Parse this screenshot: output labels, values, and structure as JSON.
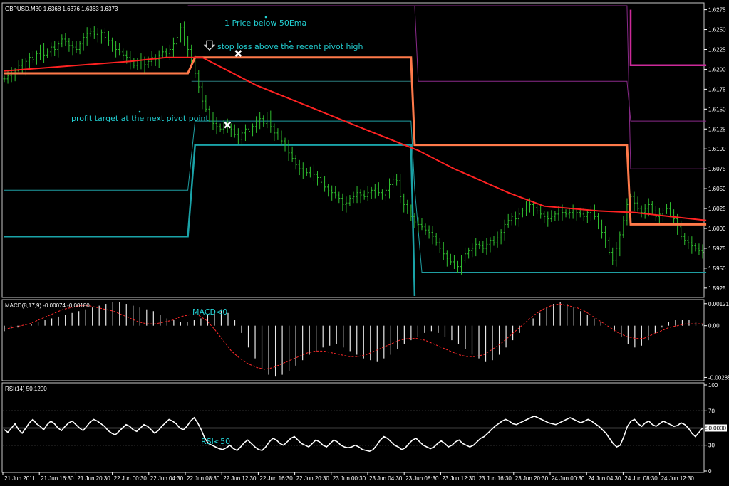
{
  "chart_data": [
    {
      "type": "line",
      "panel": "price",
      "title": "GBPUSD,M30  1.6368 1.6376 1.6363 1.6373",
      "ylim": [
        1.5915,
        1.628
      ],
      "y_ticks": [
        "1.6275",
        "1.6250",
        "1.6225",
        "1.6200",
        "1.6175",
        "1.6150",
        "1.6125",
        "1.6100",
        "1.6075",
        "1.6050",
        "1.6025",
        "1.6000",
        "1.5975",
        "1.5950",
        "1.5925"
      ],
      "x_ticks": [
        "21 Jun 2011",
        "21 Jun 16:30",
        "21 Jun 20:30",
        "22 Jun 00:30",
        "22 Jun 04:30",
        "22 Jun 08:30",
        "22 Jun 12:30",
        "22 Jun 16:30",
        "22 Jun 20:30",
        "23 Jun 00:30",
        "23 Jun 04:30",
        "23 Jun 08:30",
        "23 Jun 12:30",
        "23 Jun 16:30",
        "23 Jun 20:30",
        "24 Jun 00:30",
        "24 Jun 04:30",
        "24 Jun 08:30",
        "24 Jun 12:30"
      ],
      "bar_count": 195,
      "close": [
        1.6188,
        1.6192,
        1.6195,
        1.6198,
        1.6205,
        1.62,
        1.621,
        1.6215,
        1.6212,
        1.622,
        1.6225,
        1.6218,
        1.6222,
        1.6228,
        1.6225,
        1.6232,
        1.6238,
        1.6235,
        1.623,
        1.6228,
        1.6225,
        1.6232,
        1.624,
        1.6245,
        1.6248,
        1.6244,
        1.6242,
        1.6246,
        1.624,
        1.6236,
        1.623,
        1.6225,
        1.6222,
        1.6218,
        1.6215,
        1.621,
        1.6205,
        1.6208,
        1.6212,
        1.6206,
        1.621,
        1.6215,
        1.6212,
        1.6218,
        1.6222,
        1.622,
        1.6225,
        1.6232,
        1.624,
        1.6252,
        1.6238,
        1.6225,
        1.621,
        1.6195,
        1.6178,
        1.616,
        1.615,
        1.614,
        1.6132,
        1.6128,
        1.6125,
        1.613,
        1.6128,
        1.6125,
        1.6118,
        1.6112,
        1.612,
        1.6125,
        1.6122,
        1.6128,
        1.6135,
        1.6138,
        1.6132,
        1.614,
        1.6128,
        1.612,
        1.6115,
        1.611,
        1.6105,
        1.6095,
        1.6088,
        1.608,
        1.6075,
        1.6072,
        1.607,
        1.6072,
        1.6068,
        1.6064,
        1.6058,
        1.6052,
        1.6048,
        1.6045,
        1.6042,
        1.6038,
        1.603,
        1.6032,
        1.6038,
        1.604,
        1.6045,
        1.6042,
        1.604,
        1.6045,
        1.6048,
        1.605,
        1.6045,
        1.6042,
        1.6048,
        1.6055,
        1.6062,
        1.606,
        1.604,
        1.603,
        1.6022,
        1.6015,
        1.6008,
        1.6005,
        1.6002,
        1.5998,
        1.5995,
        1.599,
        1.5982,
        1.5975,
        1.5968,
        1.5962,
        1.5958,
        1.5955,
        1.5952,
        1.596,
        1.5968,
        1.5972,
        1.5975,
        1.598,
        1.5978,
        1.5975,
        1.598,
        1.5985,
        1.5982,
        1.5988,
        1.5995,
        1.6005,
        1.601,
        1.6015,
        1.6012,
        1.6018,
        1.6022,
        1.6028,
        1.603,
        1.6026,
        1.6022,
        1.6018,
        1.6015,
        1.6012,
        1.6015,
        1.6018,
        1.6022,
        1.602,
        1.6018,
        1.602,
        1.6022,
        1.602,
        1.6018,
        1.6015,
        1.602,
        1.6022,
        1.6015,
        1.6005,
        1.5995,
        1.5985,
        1.597,
        1.596,
        1.5975,
        1.5992,
        1.601,
        1.603,
        1.604,
        1.6032,
        1.6025,
        1.602,
        1.6025,
        1.603,
        1.6022,
        1.6015,
        1.6018,
        1.6022,
        1.6025,
        1.602,
        1.6012,
        1.6002,
        1.599,
        1.5985,
        1.5982,
        1.5978,
        1.5975,
        1.5972,
        1.597
      ],
      "ema50": [
        [
          0,
          1.6198
        ],
        [
          35,
          1.621
        ],
        [
          45,
          1.6215
        ],
        [
          55,
          1.6215
        ],
        [
          70,
          1.618
        ],
        [
          100,
          1.6125
        ],
        [
          115,
          1.6098
        ],
        [
          125,
          1.6075
        ],
        [
          140,
          1.6045
        ],
        [
          150,
          1.6028
        ],
        [
          165,
          1.6022
        ],
        [
          175,
          1.602
        ],
        [
          185,
          1.6015
        ],
        [
          195,
          1.601
        ]
      ],
      "pivot_main": [
        [
          0,
          1.6195
        ],
        [
          51,
          1.6195
        ],
        [
          53,
          1.6215
        ],
        [
          113,
          1.6215
        ],
        [
          114,
          1.6105
        ],
        [
          173,
          1.6105
        ],
        [
          174,
          1.6005
        ],
        [
          195,
          1.6005
        ]
      ],
      "pivot_r1": [
        [
          51,
          1.6305
        ],
        [
          114,
          1.6305
        ],
        [
          115,
          1.6185
        ],
        [
          173,
          1.6185
        ],
        [
          174,
          1.6135
        ],
        [
          195,
          1.6135
        ]
      ],
      "pivot_r2": [
        [
          174,
          1.6275
        ],
        [
          174,
          1.6205
        ],
        [
          195,
          1.6205
        ]
      ],
      "pivot_r3": [
        [
          114,
          1.6295
        ],
        [
          173,
          1.6295
        ],
        [
          174,
          1.6075
        ],
        [
          195,
          1.6075
        ]
      ],
      "pivot_s1": [
        [
          0,
          1.599
        ],
        [
          51,
          1.599
        ],
        [
          53,
          1.6105
        ],
        [
          113,
          1.6105
        ],
        [
          114,
          1.5915
        ]
      ],
      "pivot_s2": [
        [
          0,
          1.6048
        ],
        [
          51,
          1.6048
        ],
        [
          53,
          1.6135
        ],
        [
          113,
          1.6135
        ],
        [
          114,
          1.605
        ],
        [
          116,
          1.5945
        ],
        [
          195,
          1.5945
        ]
      ],
      "pivot_s3": [
        [
          52,
          1.6185
        ],
        [
          113,
          1.6185
        ]
      ],
      "markers": [
        {
          "label": "stop-x",
          "x": 65,
          "y": 1.622
        },
        {
          "label": "entry-x",
          "x": 62,
          "y": 1.613
        },
        {
          "label": "arrow",
          "x": 57,
          "y": 1.6227
        }
      ],
      "annotations": {
        "a1": "1 Price below 50Ema",
        "a2": "stop loss above the recent pivot high",
        "a3": "profit target at the next pivot point"
      }
    },
    {
      "type": "bar",
      "panel": "macd",
      "title": "MACD(8,17,9) -0.00074 -0.00180",
      "ylim": [
        -0.00295,
        0.00128
      ],
      "y_ticks": [
        "0.00121",
        "0.00",
        "-0.00285"
      ],
      "annotation": "MACD<0",
      "histogram": [
        -0.0003,
        -0.0002,
        -0.0001,
        0.0,
        0.0001,
        0.0002,
        0.0003,
        0.0004,
        0.0005,
        0.0006,
        0.0007,
        0.0008,
        0.0009,
        0.001,
        0.0011,
        0.0012,
        0.0013,
        0.0013,
        0.0012,
        0.0011,
        0.001,
        0.0009,
        0.0008,
        0.0006,
        0.0004,
        0.0003,
        0.0002,
        0.0002,
        0.0003,
        0.0004,
        0.0006,
        0.0008,
        0.0009,
        0.0007,
        0.0003,
        -0.0004,
        -0.0012,
        -0.0018,
        -0.0024,
        -0.0027,
        -0.0028,
        -0.0027,
        -0.0025,
        -0.0022,
        -0.0019,
        -0.0016,
        -0.0014,
        -0.0012,
        -0.0011,
        -0.001,
        -0.0012,
        -0.0014,
        -0.0016,
        -0.0018,
        -0.0019,
        -0.002,
        -0.0018,
        -0.0016,
        -0.0013,
        -0.001,
        -0.0008,
        -0.0006,
        -0.0004,
        -0.0003,
        -0.0004,
        -0.0006,
        -0.0008,
        -0.001,
        -0.0013,
        -0.0016,
        -0.0018,
        -0.002,
        -0.0019,
        -0.0016,
        -0.0012,
        -0.0008,
        -0.0004,
        0.0,
        0.0004,
        0.0007,
        0.001,
        0.0012,
        0.0013,
        0.0012,
        0.001,
        0.0008,
        0.0006,
        0.0004,
        0.0002,
        0.0,
        -0.0003,
        -0.0006,
        -0.001,
        -0.0012,
        -0.0011,
        -0.0008,
        -0.0004,
        -0.0001,
        0.0002,
        0.0003,
        0.0003,
        0.0003,
        0.0002,
        0.0001
      ],
      "signal": [
        -0.0002,
        -0.0001,
        0.0,
        0.0001,
        0.0003,
        0.0005,
        0.0007,
        0.0009,
        0.001,
        0.0011,
        0.0011,
        0.001,
        0.0009,
        0.0008,
        0.0006,
        0.0004,
        0.0002,
        0.0001,
        0.0001,
        0.0002,
        0.0003,
        0.0005,
        0.0006,
        0.0006,
        0.0003,
        -0.0002,
        -0.0008,
        -0.0014,
        -0.0018,
        -0.0021,
        -0.0023,
        -0.0024,
        -0.0023,
        -0.0021,
        -0.0019,
        -0.0017,
        -0.0015,
        -0.0014,
        -0.0014,
        -0.0015,
        -0.0016,
        -0.0017,
        -0.0017,
        -0.0016,
        -0.0014,
        -0.0012,
        -0.001,
        -0.0008,
        -0.0007,
        -0.0007,
        -0.0008,
        -0.001,
        -0.0012,
        -0.0014,
        -0.0016,
        -0.0017,
        -0.0017,
        -0.0016,
        -0.0013,
        -0.001,
        -0.0006,
        -0.0002,
        0.0002,
        0.0006,
        0.0009,
        0.0011,
        0.0012,
        0.0011,
        0.001,
        0.0008,
        0.0005,
        0.0002,
        -0.0001,
        -0.0004,
        -0.0006,
        -0.0007,
        -0.0007,
        -0.0005,
        -0.0003,
        -0.0001,
        0.0,
        0.0001,
        0.0001,
        0.0001
      ]
    },
    {
      "type": "line",
      "panel": "rsi",
      "title": "RSI(14) 50.1200",
      "ylim": [
        0,
        100
      ],
      "y_ticks": [
        "100",
        "70",
        "50.0000",
        "30",
        "0"
      ],
      "levels": [
        70,
        50,
        30
      ],
      "annotation": "RSI<50",
      "values": [
        48,
        45,
        50,
        55,
        48,
        44,
        50,
        56,
        60,
        55,
        52,
        48,
        54,
        58,
        55,
        50,
        47,
        52,
        56,
        58,
        54,
        50,
        47,
        52,
        57,
        60,
        58,
        55,
        52,
        47,
        44,
        42,
        46,
        50,
        54,
        52,
        48,
        46,
        50,
        54,
        52,
        48,
        44,
        47,
        52,
        56,
        60,
        58,
        55,
        50,
        48,
        52,
        58,
        62,
        56,
        48,
        38,
        32,
        30,
        28,
        26,
        25,
        27,
        30,
        26,
        24,
        28,
        33,
        36,
        32,
        28,
        25,
        24,
        28,
        34,
        38,
        36,
        32,
        30,
        34,
        38,
        40,
        36,
        32,
        30,
        28,
        32,
        36,
        34,
        30,
        28,
        32,
        36,
        34,
        30,
        28,
        27,
        28,
        30,
        28,
        25,
        24,
        23,
        25,
        30,
        36,
        40,
        38,
        34,
        30,
        28,
        25,
        27,
        32,
        36,
        38,
        34,
        30,
        28,
        26,
        28,
        32,
        35,
        32,
        28,
        30,
        34,
        36,
        32,
        30,
        28,
        30,
        34,
        38,
        40,
        44,
        48,
        52,
        55,
        58,
        60,
        58,
        55,
        54,
        56,
        58,
        60,
        62,
        64,
        62,
        60,
        58,
        56,
        55,
        54,
        56,
        58,
        60,
        62,
        60,
        58,
        56,
        58,
        60,
        58,
        55,
        52,
        48,
        44,
        38,
        32,
        28,
        30,
        40,
        52,
        58,
        60,
        55,
        52,
        56,
        58,
        54,
        52,
        55,
        58,
        56,
        54,
        52,
        53,
        56,
        54,
        50,
        44,
        40,
        45,
        50
      ]
    }
  ]
}
